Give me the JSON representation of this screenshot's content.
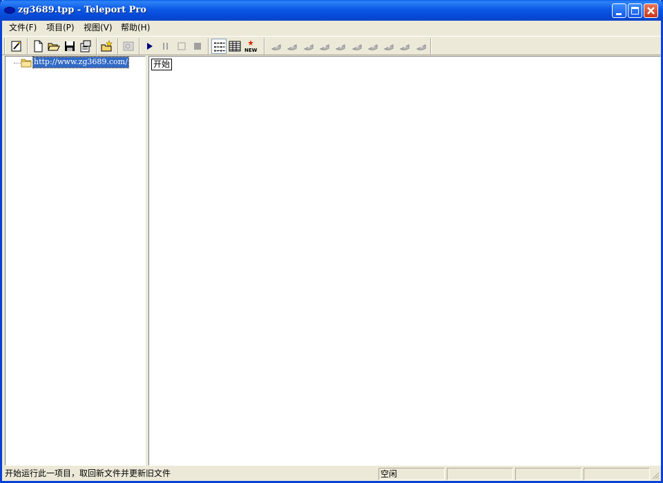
{
  "window": {
    "title": "zg3689.tpp - Teleport Pro",
    "icon": "teleport-app-icon"
  },
  "title_buttons": {
    "minimize": "minimize-icon",
    "maximize": "maximize-icon",
    "close": "close-icon"
  },
  "menu": {
    "items": [
      {
        "label": "文件(F)"
      },
      {
        "label": "项目(P)"
      },
      {
        "label": "视图(V)"
      },
      {
        "label": "帮助(H)"
      }
    ]
  },
  "toolbar": {
    "buttons": [
      "edit-project-icon",
      "new-file-icon",
      "open-folder-icon",
      "save-icon",
      "project-properties-icon",
      "new-folder-icon",
      "browse-icon",
      "start-icon",
      "pause-icon",
      "stop-icon",
      "stop-all-icon",
      "list-view-icon",
      "detail-view-icon",
      "new-files-icon",
      "bookmark-icon-1",
      "bookmark-icon-2",
      "bookmark-icon-3",
      "bookmark-icon-4",
      "bookmark-icon-5",
      "bookmark-icon-6",
      "bookmark-icon-7",
      "bookmark-icon-8",
      "bookmark-icon-9",
      "bookmark-icon-10"
    ]
  },
  "tree": {
    "root_url": "http://www.zg3689.com/"
  },
  "content": {
    "start_label": "开始"
  },
  "status": {
    "message": "开始运行此一项目，取回新文件并更新旧文件",
    "state": "空闲"
  },
  "colors": {
    "titlebar": "#0a58e6",
    "selection": "#316ac5",
    "chrome": "#ece9d8"
  }
}
